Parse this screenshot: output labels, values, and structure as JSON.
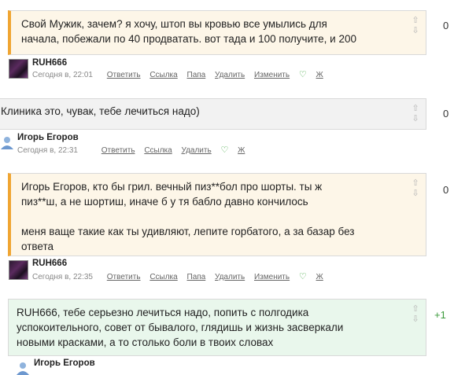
{
  "comments": [
    {
      "text_lines": [
        "Свой Мужик, зачем? я хочу, штоп вы кровью все умылись для",
        "начала, побежали по 40 продватать. вот тада и 100 получите, и 200"
      ],
      "score": "0",
      "author": "RUH666",
      "date": "Сегодня в, 22:01",
      "actions": [
        "Ответить",
        "Ссылка",
        "Папа",
        "Удалить",
        "Изменить"
      ],
      "extra": "Ж"
    },
    {
      "text_lines": [
        "Клиника это, чувак, тебе лечиться надо)"
      ],
      "score": "0",
      "author": "Игорь Егоров",
      "date": "Сегодня в, 22:31",
      "actions": [
        "Ответить",
        "Ссылка",
        "Удалить"
      ],
      "extra": "Ж"
    },
    {
      "text_lines": [
        "Игорь Егоров, кто бы грил. вечный пиз**бол про шорты. ты ж",
        "пиз**ш, а не шортиш, иначе б у тя бабло давно кончилось"
      ],
      "text_lines_2": [
        "меня ваще такие как ты удивляют, лепите горбатого, а за базар без",
        "ответа"
      ],
      "score": "0",
      "author": "RUH666",
      "date": "Сегодня в, 22:35",
      "actions": [
        "Ответить",
        "Ссылка",
        "Папа",
        "Удалить",
        "Изменить"
      ],
      "extra": "Ж"
    },
    {
      "text_lines": [
        "RUH666, тебе серьезно лечиться надо, попить с полгодика",
        "успокоительного, совет от бывалого, глядишь и жизнь засверкали",
        "новыми красками, а то столько боли в твоих словах"
      ],
      "score": "+1",
      "author": "Игорь Егоров"
    }
  ],
  "icons": {
    "vote_up": "arrow-up-icon",
    "vote_down": "arrow-down-icon",
    "like": "heart-icon"
  },
  "colors": {
    "accent_orange": "#f0a532",
    "delete_red": "#cc2222",
    "heart_green": "#36a336",
    "positive_score": "#3d9b3d"
  }
}
